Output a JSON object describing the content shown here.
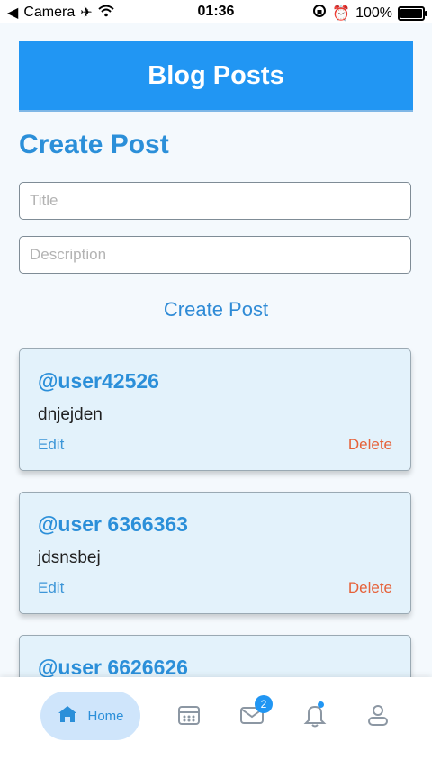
{
  "status_bar": {
    "carrier": "Camera",
    "time": "01:36",
    "battery": "100%"
  },
  "header": {
    "title": "Blog Posts"
  },
  "create_section": {
    "title": "Create Post",
    "title_placeholder": "Title",
    "description_placeholder": "Description",
    "button_label": "Create Post"
  },
  "posts": [
    {
      "user": "@user42526",
      "body": "dnjejden",
      "edit_label": "Edit",
      "delete_label": "Delete"
    },
    {
      "user": "@user 6366363",
      "body": "jdsnsbej",
      "edit_label": "Edit",
      "delete_label": "Delete"
    },
    {
      "user": "@user 6626626",
      "body": "",
      "edit_label": "",
      "delete_label": ""
    }
  ],
  "bottom_nav": {
    "home_label": "Home",
    "mail_badge": "2",
    "icons": [
      "home-icon",
      "calendar-icon",
      "mail-icon",
      "bell-icon",
      "profile-icon"
    ]
  },
  "colors": {
    "primary": "#2196f3",
    "title_blue": "#2b8fd9",
    "delete_red": "#e6623a",
    "card_bg": "#e3f2fb"
  }
}
